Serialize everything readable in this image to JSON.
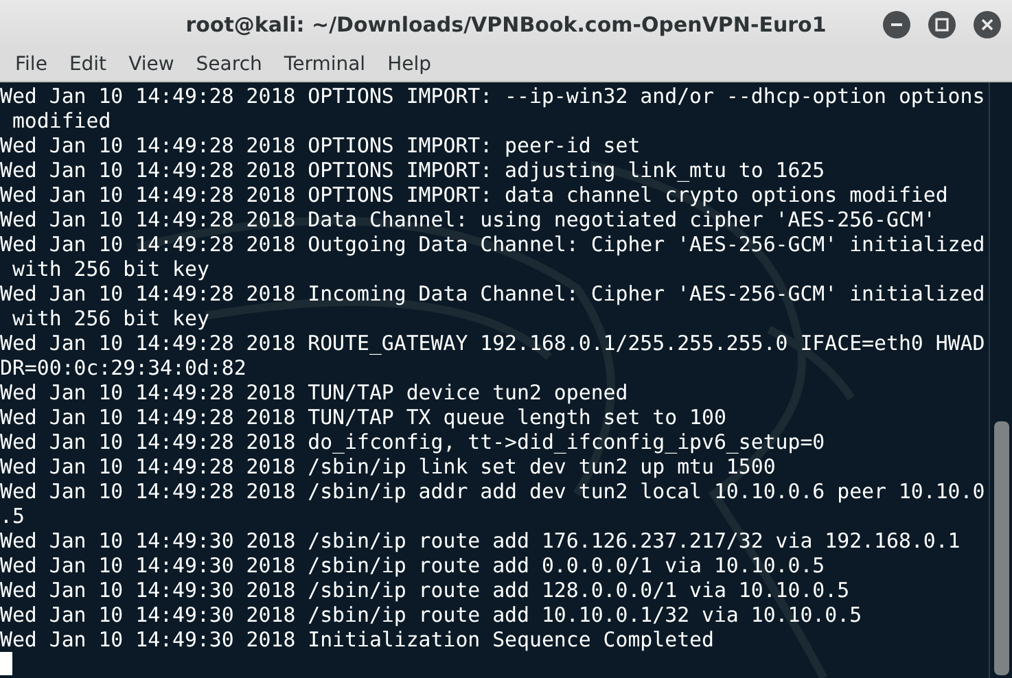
{
  "window": {
    "title": "root@kali: ~/Downloads/VPNBook.com-OpenVPN-Euro1"
  },
  "menu": [
    "File",
    "Edit",
    "View",
    "Search",
    "Terminal",
    "Help"
  ],
  "terminal": {
    "lines": [
      "Wed Jan 10 14:49:28 2018 OPTIONS IMPORT: --ip-win32 and/or --dhcp-option options",
      " modified",
      "Wed Jan 10 14:49:28 2018 OPTIONS IMPORT: peer-id set",
      "Wed Jan 10 14:49:28 2018 OPTIONS IMPORT: adjusting link_mtu to 1625",
      "Wed Jan 10 14:49:28 2018 OPTIONS IMPORT: data channel crypto options modified",
      "Wed Jan 10 14:49:28 2018 Data Channel: using negotiated cipher 'AES-256-GCM'",
      "Wed Jan 10 14:49:28 2018 Outgoing Data Channel: Cipher 'AES-256-GCM' initialized",
      " with 256 bit key",
      "Wed Jan 10 14:49:28 2018 Incoming Data Channel: Cipher 'AES-256-GCM' initialized",
      " with 256 bit key",
      "Wed Jan 10 14:49:28 2018 ROUTE_GATEWAY 192.168.0.1/255.255.255.0 IFACE=eth0 HWAD",
      "DR=00:0c:29:34:0d:82",
      "Wed Jan 10 14:49:28 2018 TUN/TAP device tun2 opened",
      "Wed Jan 10 14:49:28 2018 TUN/TAP TX queue length set to 100",
      "Wed Jan 10 14:49:28 2018 do_ifconfig, tt->did_ifconfig_ipv6_setup=0",
      "Wed Jan 10 14:49:28 2018 /sbin/ip link set dev tun2 up mtu 1500",
      "Wed Jan 10 14:49:28 2018 /sbin/ip addr add dev tun2 local 10.10.0.6 peer 10.10.0",
      ".5",
      "Wed Jan 10 14:49:30 2018 /sbin/ip route add 176.126.237.217/32 via 192.168.0.1",
      "Wed Jan 10 14:49:30 2018 /sbin/ip route add 0.0.0.0/1 via 10.10.0.5",
      "Wed Jan 10 14:49:30 2018 /sbin/ip route add 128.0.0.0/1 via 10.10.0.5",
      "Wed Jan 10 14:49:30 2018 /sbin/ip route add 10.10.0.1/32 via 10.10.0.5",
      "Wed Jan 10 14:49:30 2018 Initialization Sequence Completed"
    ]
  }
}
